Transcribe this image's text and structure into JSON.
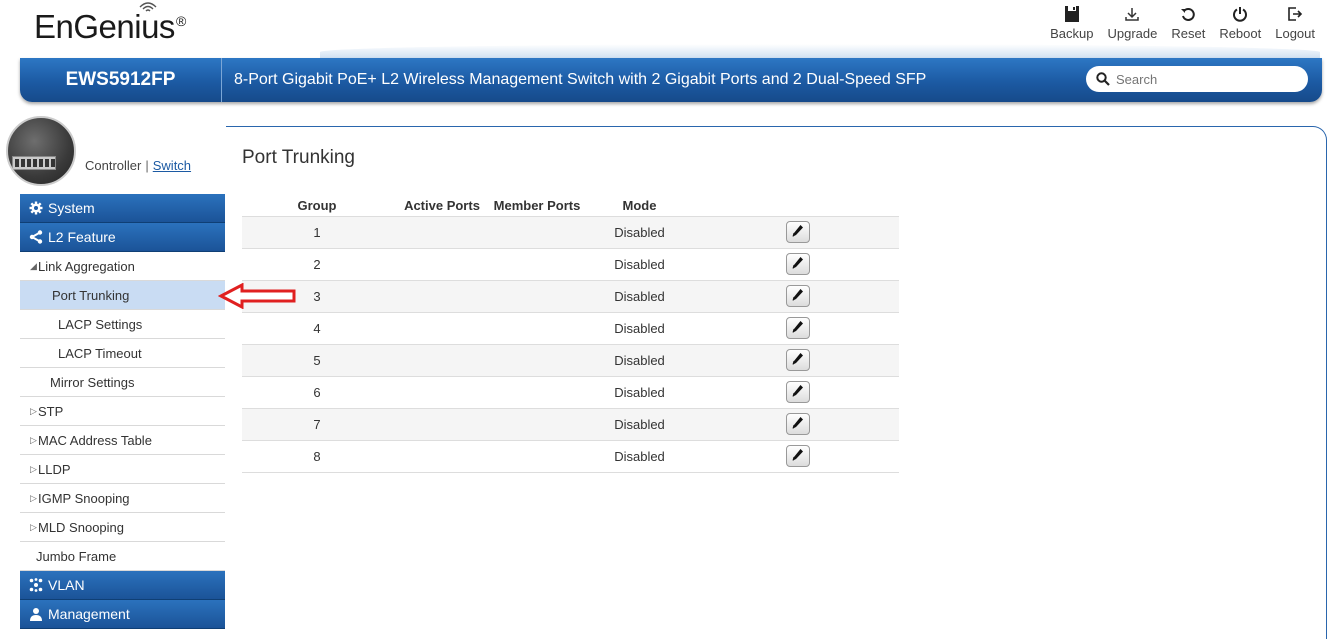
{
  "header": {
    "logo_text": "EnGenius",
    "logo_mark": "®",
    "toolbar": [
      {
        "label": "Backup",
        "icon": "save-icon"
      },
      {
        "label": "Upgrade",
        "icon": "upload-icon"
      },
      {
        "label": "Reset",
        "icon": "reset-icon"
      },
      {
        "label": "Reboot",
        "icon": "power-icon"
      },
      {
        "label": "Logout",
        "icon": "logout-icon"
      }
    ]
  },
  "titlebar": {
    "model": "EWS5912FP",
    "description": "8-Port Gigabit PoE+ L2 Wireless Management Switch with 2 Gigabit Ports and 2 Dual-Speed SFP",
    "search_placeholder": "Search"
  },
  "sidebar": {
    "mode_controller": "Controller",
    "mode_separator": "|",
    "mode_switch": "Switch",
    "sections": {
      "system": "System",
      "l2_feature": "L2 Feature",
      "vlan": "VLAN",
      "management": "Management"
    },
    "items": {
      "link_aggregation": "Link Aggregation",
      "port_trunking": "Port Trunking",
      "lacp_settings": "LACP Settings",
      "lacp_timeout": "LACP Timeout",
      "mirror_settings": "Mirror Settings",
      "stp": "STP",
      "mac_address_table": "MAC Address Table",
      "lldp": "LLDP",
      "igmp_snooping": "IGMP Snooping",
      "mld_snooping": "MLD Snooping",
      "jumbo_frame": "Jumbo Frame"
    },
    "expand_open_glyph": "◢",
    "expand_closed_glyph": "▷"
  },
  "main": {
    "title": "Port Trunking",
    "columns": [
      "Group",
      "Active Ports",
      "Member Ports",
      "Mode"
    ],
    "rows": [
      {
        "group": "1",
        "active": "",
        "member": "",
        "mode": "Disabled"
      },
      {
        "group": "2",
        "active": "",
        "member": "",
        "mode": "Disabled"
      },
      {
        "group": "3",
        "active": "",
        "member": "",
        "mode": "Disabled"
      },
      {
        "group": "4",
        "active": "",
        "member": "",
        "mode": "Disabled"
      },
      {
        "group": "5",
        "active": "",
        "member": "",
        "mode": "Disabled"
      },
      {
        "group": "6",
        "active": "",
        "member": "",
        "mode": "Disabled"
      },
      {
        "group": "7",
        "active": "",
        "member": "",
        "mode": "Disabled"
      },
      {
        "group": "8",
        "active": "",
        "member": "",
        "mode": "Disabled"
      }
    ]
  },
  "colors": {
    "brand_blue": "#1c5aa3",
    "selected_row": "#c9dcf3",
    "annotation_red": "#e02020"
  }
}
